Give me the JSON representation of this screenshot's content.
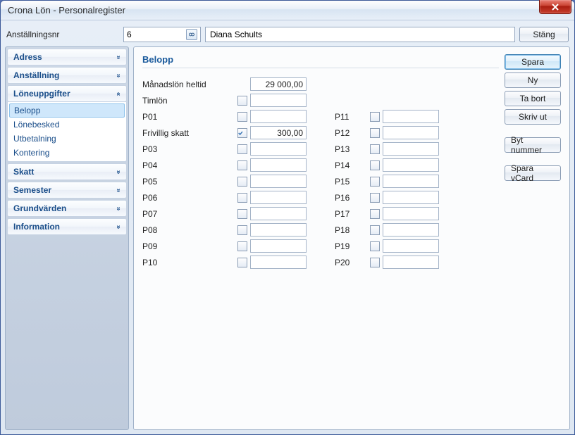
{
  "window": {
    "title": "Crona Lön - Personalregister"
  },
  "toolbar": {
    "label": "Anställningsnr",
    "id_value": "6",
    "name_value": "Diana Schults",
    "close_label": "Stäng"
  },
  "sidebar": {
    "sections": [
      {
        "label": "Adress",
        "expanded": false
      },
      {
        "label": "Anställning",
        "expanded": false
      },
      {
        "label": "Löneuppgifter",
        "expanded": true,
        "items": [
          "Belopp",
          "Lönebesked",
          "Utbetalning",
          "Kontering"
        ],
        "selected": "Belopp"
      },
      {
        "label": "Skatt",
        "expanded": false
      },
      {
        "label": "Semester",
        "expanded": false
      },
      {
        "label": "Grundvärden",
        "expanded": false
      },
      {
        "label": "Information",
        "expanded": false
      }
    ]
  },
  "panel": {
    "title": "Belopp",
    "row_monthly": {
      "label": "Månadslön heltid",
      "value": "29 000,00"
    },
    "left_rows": [
      {
        "label": "Timlön",
        "checked": false,
        "value": ""
      },
      {
        "label": "P01",
        "checked": false,
        "value": ""
      },
      {
        "label": "Frivillig skatt",
        "checked": true,
        "value": "300,00"
      },
      {
        "label": "P03",
        "checked": false,
        "value": ""
      },
      {
        "label": "P04",
        "checked": false,
        "value": ""
      },
      {
        "label": "P05",
        "checked": false,
        "value": ""
      },
      {
        "label": "P06",
        "checked": false,
        "value": ""
      },
      {
        "label": "P07",
        "checked": false,
        "value": ""
      },
      {
        "label": "P08",
        "checked": false,
        "value": ""
      },
      {
        "label": "P09",
        "checked": false,
        "value": ""
      },
      {
        "label": "P10",
        "checked": false,
        "value": ""
      }
    ],
    "right_rows": [
      {
        "label": "P11",
        "checked": false,
        "value": ""
      },
      {
        "label": "P12",
        "checked": false,
        "value": ""
      },
      {
        "label": "P13",
        "checked": false,
        "value": ""
      },
      {
        "label": "P14",
        "checked": false,
        "value": ""
      },
      {
        "label": "P15",
        "checked": false,
        "value": ""
      },
      {
        "label": "P16",
        "checked": false,
        "value": ""
      },
      {
        "label": "P17",
        "checked": false,
        "value": ""
      },
      {
        "label": "P18",
        "checked": false,
        "value": ""
      },
      {
        "label": "P19",
        "checked": false,
        "value": ""
      },
      {
        "label": "P20",
        "checked": false,
        "value": ""
      }
    ]
  },
  "buttons": {
    "save": "Spara",
    "new": "Ny",
    "delete": "Ta bort",
    "print": "Skriv ut",
    "change_number": "Byt nummer",
    "save_vcard": "Spara vCard"
  }
}
